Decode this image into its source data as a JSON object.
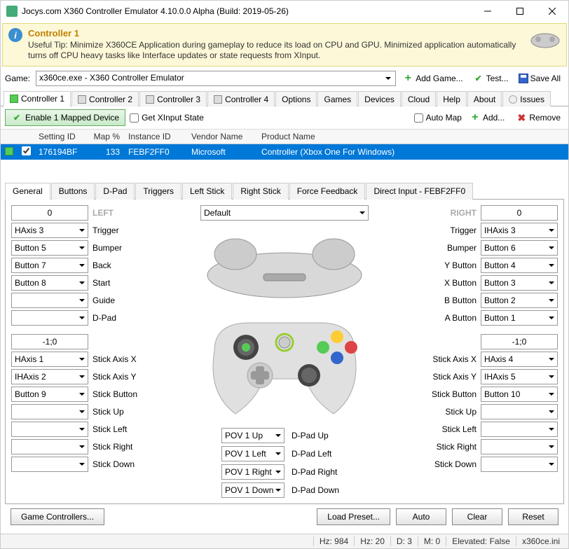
{
  "window": {
    "title": "Jocys.com X360 Controller Emulator 4.10.0.0 Alpha (Build: 2019-05-26)"
  },
  "tip": {
    "heading": "Controller 1",
    "text": "Useful Tip: Minimize X360CE Application during gameplay to reduce its load on CPU and GPU. Minimized application automatically turns off CPU heavy tasks like Interface updates or state requests from XInput."
  },
  "gamebar": {
    "label": "Game:",
    "selected": "x360ce.exe - X360 Controller Emulator",
    "add_game": "Add Game...",
    "test": "Test...",
    "save_all": "Save All"
  },
  "maintabs": [
    "Controller 1",
    "Controller 2",
    "Controller 3",
    "Controller 4",
    "Options",
    "Games",
    "Devices",
    "Cloud",
    "Help",
    "About",
    "Issues"
  ],
  "toolbar2": {
    "enable": "Enable 1 Mapped Device",
    "getx": "Get XInput State",
    "automap": "Auto Map",
    "add": "Add...",
    "remove": "Remove"
  },
  "grid": {
    "headers": {
      "setting": "Setting ID",
      "map": "Map %",
      "instance": "Instance ID",
      "vendor": "Vendor Name",
      "product": "Product Name"
    },
    "row": {
      "setting": "176194BF",
      "map": "133",
      "instance": "FEBF2FF0",
      "vendor": "Microsoft",
      "product": "Controller (Xbox One For Windows)"
    }
  },
  "subtabs": [
    "General",
    "Buttons",
    "D-Pad",
    "Triggers",
    "Left Stick",
    "Right Stick",
    "Force Feedback",
    "Direct Input - FEBF2FF0"
  ],
  "cfg": {
    "left_num": "0",
    "right_num": "0",
    "left_hdr": "LEFT",
    "right_hdr": "RIGHT",
    "default_sel": "Default",
    "left_neg": "-1;0",
    "right_neg": "-1;0",
    "left": {
      "trigger": {
        "l": "Trigger",
        "v": "HAxis 3"
      },
      "bumper": {
        "l": "Bumper",
        "v": "Button 5"
      },
      "back": {
        "l": "Back",
        "v": "Button 7"
      },
      "start": {
        "l": "Start",
        "v": "Button 8"
      },
      "guide": {
        "l": "Guide",
        "v": ""
      },
      "dpad": {
        "l": "D-Pad",
        "v": ""
      },
      "sax": {
        "l": "Stick Axis X",
        "v": "HAxis 1"
      },
      "say": {
        "l": "Stick Axis Y",
        "v": "IHAxis 2"
      },
      "sbtn": {
        "l": "Stick Button",
        "v": "Button 9"
      },
      "sup": {
        "l": "Stick Up",
        "v": ""
      },
      "sleft": {
        "l": "Stick Left",
        "v": ""
      },
      "sright": {
        "l": "Stick Right",
        "v": ""
      },
      "sdown": {
        "l": "Stick Down",
        "v": ""
      }
    },
    "right": {
      "trigger": {
        "l": "Trigger",
        "v": "IHAxis 3"
      },
      "bumper": {
        "l": "Bumper",
        "v": "Button 6"
      },
      "ybtn": {
        "l": "Y Button",
        "v": "Button 4"
      },
      "xbtn": {
        "l": "X Button",
        "v": "Button 3"
      },
      "bbtn": {
        "l": "B Button",
        "v": "Button 2"
      },
      "abtn": {
        "l": "A Button",
        "v": "Button 1"
      },
      "sax": {
        "l": "Stick Axis X",
        "v": "HAxis 4"
      },
      "say": {
        "l": "Stick Axis Y",
        "v": "IHAxis 5"
      },
      "sbtn": {
        "l": "Stick Button",
        "v": "Button 10"
      },
      "sup": {
        "l": "Stick Up",
        "v": ""
      },
      "sleft": {
        "l": "Stick Left",
        "v": ""
      },
      "sright": {
        "l": "Stick Right",
        "v": ""
      },
      "sdown": {
        "l": "Stick Down",
        "v": ""
      }
    },
    "pov": {
      "up": {
        "v": "POV 1 Up",
        "l": "D-Pad Up"
      },
      "left": {
        "v": "POV 1 Left",
        "l": "D-Pad Left"
      },
      "right": {
        "v": "POV 1 Right",
        "l": "D-Pad Right"
      },
      "down": {
        "v": "POV 1 Down",
        "l": "D-Pad Down"
      }
    }
  },
  "bottom": {
    "game_ctrl": "Game Controllers...",
    "load": "Load Preset...",
    "auto": "Auto",
    "clear": "Clear",
    "reset": "Reset"
  },
  "status": {
    "hz1": "Hz: 984",
    "hz2": "Hz: 20",
    "d": "D: 3",
    "m": "M: 0",
    "elev": "Elevated: False",
    "ini": "x360ce.ini"
  }
}
